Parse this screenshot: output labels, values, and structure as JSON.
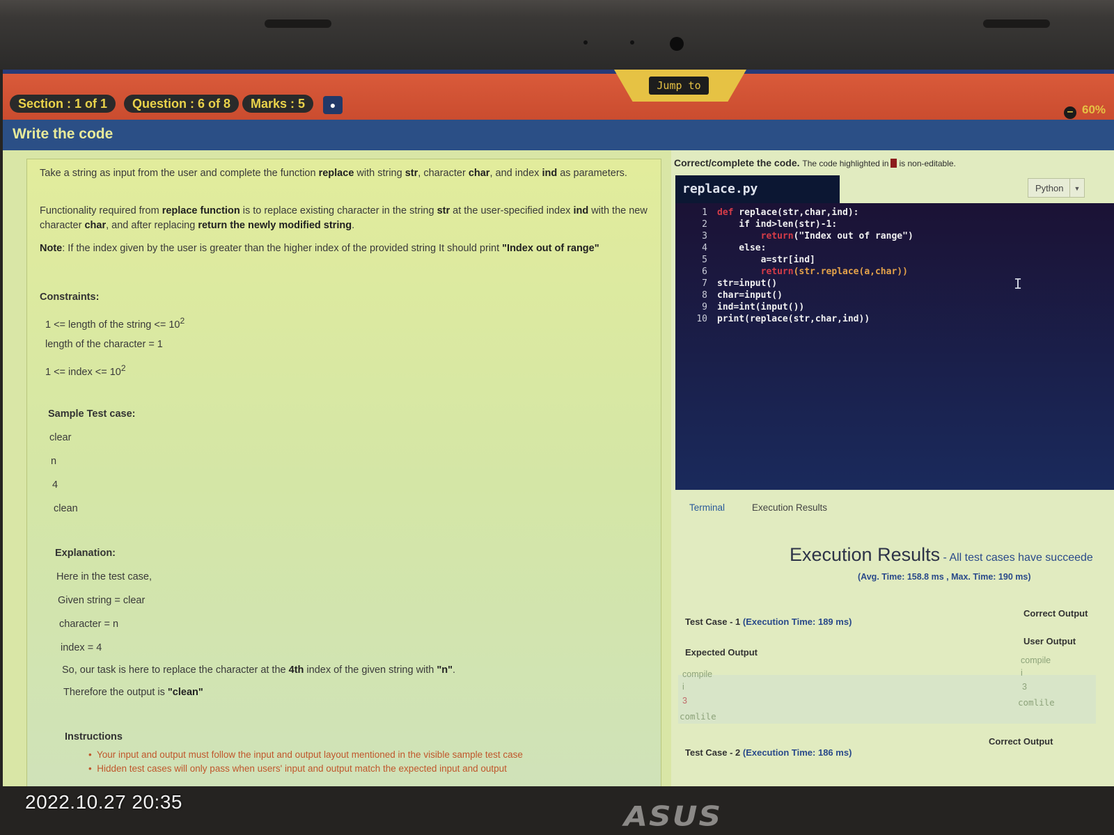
{
  "header": {
    "section": "Section : 1 of 1",
    "question": "Question : 6 of 8",
    "marks": "Marks : 5",
    "jump_to": "Jump to",
    "timer": "60%"
  },
  "title": "Write the code",
  "problem": {
    "intro": {
      "t1": "Take a string as input from the user and complete the function ",
      "replace": "replace",
      "t2": " with string ",
      "str": "str",
      "t3": ", character ",
      "char": "char",
      "t4": ", and index ",
      "ind": "ind",
      "t5": " as parameters."
    },
    "func": {
      "t1": "Functionality required from ",
      "rf": "replace function",
      "t2": " is to replace existing character in the string ",
      "str": "str",
      "t3": " at the user-specified index ",
      "ind": "ind",
      "t4": " with the new character ",
      "char": "char",
      "t5": ", and after replacing ",
      "ret": "return the newly modified string",
      "t6": "."
    },
    "note": {
      "label": "Note",
      "t1": ": If the index given by the user is greater than the higher index of the provided string It should print ",
      "msg": "\"Index out of range\""
    },
    "constraints_title": "Constraints:",
    "constraints": [
      {
        "base": "1 <= length of the string <= 10",
        "sup": "2"
      },
      {
        "base": "length of the character = 1",
        "sup": ""
      },
      {
        "base": "1 <= index <= 10",
        "sup": "2"
      }
    ],
    "sample_title": "Sample Test case:",
    "sample": [
      "clear",
      "n",
      "4",
      "clean"
    ],
    "explanation_title": "Explanation:",
    "explanation": [
      "Here in the test case,",
      "Given string = clear",
      "character = n",
      "index = 4"
    ],
    "task": {
      "t1": "So, our task is here to replace the character at the ",
      "b": "4th",
      "t2": " index of the given string with ",
      "q": "\"n\"",
      "t3": "."
    },
    "therefore": {
      "t1": "Therefore the output is ",
      "q": "\"clean\""
    },
    "instructions_title": "Instructions",
    "instructions": [
      "Your input and output must follow the input and output layout mentioned in the visible sample test case",
      "Hidden test cases will only pass when users' input and output match the expected input and output"
    ]
  },
  "editor": {
    "heading_bold": "Correct/complete the code.",
    "heading_note1": "The code highlighted in",
    "heading_note2": "is non-editable.",
    "filename": "replace.py",
    "language": "Python",
    "line_numbers": [
      "1",
      "2",
      "3",
      "4",
      "5",
      "6",
      "7",
      "8",
      "9",
      "10"
    ],
    "lines": {
      "l1_def": "def",
      "l1_rest": " replace(str,char,ind):",
      "l2_if": "    if ind>len(str)-1:",
      "l3_ret": "        return",
      "l3_rest": "(\"Index out of range\")",
      "l4": "    else:",
      "l5": "        a=str[ind]",
      "l6_ret": "        return",
      "l6_rest": "(str.replace(a,char))",
      "l7": "str=input()",
      "l8": "char=input()",
      "l9": "ind=int(input())",
      "l10": "print(replace(str,char,ind))"
    }
  },
  "tabs": [
    "Terminal",
    "Execution Results"
  ],
  "results": {
    "title": "Execution Results",
    "subtitle": " - All test cases have succeede",
    "avg": "(Avg. Time: 158.8 ms , Max. Time: 190 ms)",
    "tc1_label": "Test Case - 1 ",
    "tc1_time": "(Execution Time: 189 ms)",
    "tc1_status": "Correct Output",
    "user_output": "User Output",
    "expected_output": "Expected Output",
    "expected_lines": [
      "compile",
      "i",
      "3",
      "comlile"
    ],
    "user_lines": [
      "compile",
      "i",
      "3",
      "comlile"
    ],
    "tc2_label": "Test Case - 2 ",
    "tc2_time": "(Execution Time: 186 ms)",
    "tc2_status": "Correct Output"
  },
  "overlay": {
    "timestamp": "2022.10.27 20:35",
    "brand": "ASUS"
  }
}
